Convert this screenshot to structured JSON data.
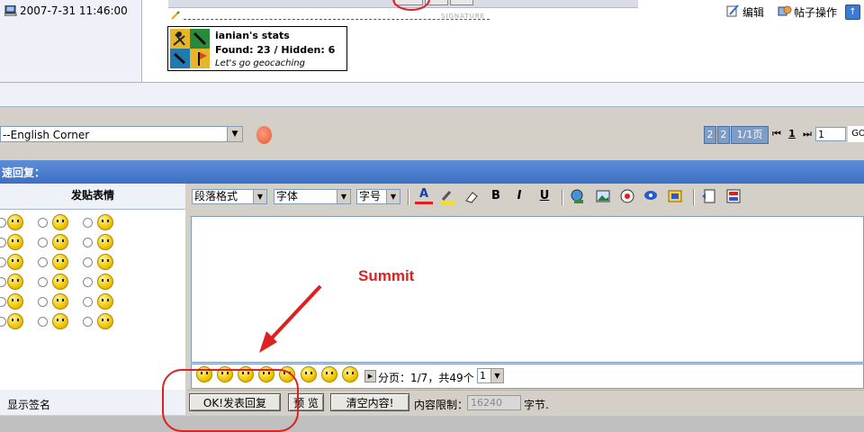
{
  "post": {
    "signature_label": "SIGNATURE",
    "stats_name": "ianian's stats",
    "stats_found": "Found: 23 / Hidden: 6",
    "stats_tagline": "Let's go geocaching",
    "datetime": "2007-7-31 11:46:00",
    "edit_label": "编辑",
    "post_ops_label": "帖子操作",
    "top_arrow": "↑"
  },
  "nav": {
    "forum_select_value": "--English Corner",
    "pager": {
      "page_a": "2",
      "page_b": "2",
      "page_info": "1/1页",
      "first": "⏮",
      "current": "1",
      "last": "⏭",
      "input_value": "1",
      "go_label": "GO"
    }
  },
  "quick_reply": {
    "title": "速回复："
  },
  "smileys": {
    "title": "发贴表情"
  },
  "toolbar": {
    "paragraph_format": "段落格式",
    "font": "字体",
    "font_size": "字号",
    "bold": "B",
    "italic": "I",
    "underline": "U",
    "text_color": "A"
  },
  "annotation": {
    "label": "Summit",
    "color": "#e02020"
  },
  "emoticon_bar": {
    "page_text": "分页：1/7，共49个",
    "page_select": "1"
  },
  "bottom": {
    "show_signature_label": "显示签名",
    "submit_label": "OK!发表回复",
    "preview_label": "预 览",
    "clear_label": "清空内容!",
    "limit_label": "内容限制：",
    "limit_value": "16240",
    "limit_unit": "字节."
  }
}
